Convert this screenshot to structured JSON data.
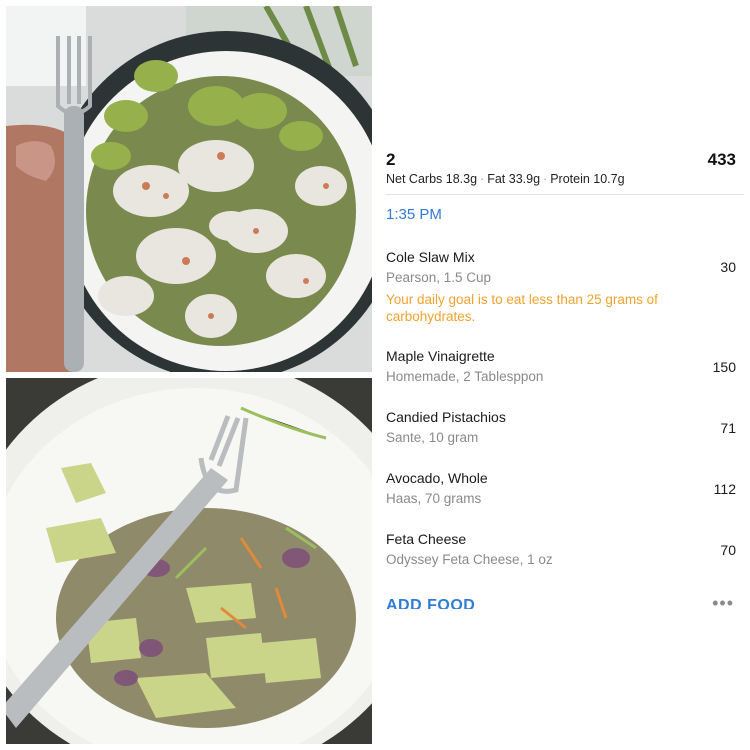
{
  "meal": {
    "number": "2",
    "calories": "433",
    "macros": {
      "net_carbs": "Net Carbs 18.3g",
      "fat": "Fat 33.9g",
      "protein": "Protein 10.7g",
      "separator": "·"
    },
    "time": "1:35 PM"
  },
  "entries": [
    {
      "name": "Cole Slaw Mix",
      "detail": "Pearson, 1.5 Cup",
      "calories": "30",
      "note": "Your daily goal is to eat less than 25 grams of carbohydrates."
    },
    {
      "name": "Maple Vinaigrette",
      "detail": "Homemade, 2 Tablesppon",
      "calories": "150"
    },
    {
      "name": "Candied Pistachios",
      "detail": "Sante, 10 gram",
      "calories": "71"
    },
    {
      "name": "Avocado, Whole",
      "detail": "Haas, 70 grams",
      "calories": "112"
    },
    {
      "name": "Feta Cheese",
      "detail": "Odyssey Feta Cheese, 1 oz",
      "calories": "70"
    }
  ],
  "actions": {
    "add_food": "ADD FOOD",
    "more": "•••"
  },
  "colors": {
    "accent_blue": "#2f7bd6",
    "warning_orange": "#f0a32c"
  }
}
